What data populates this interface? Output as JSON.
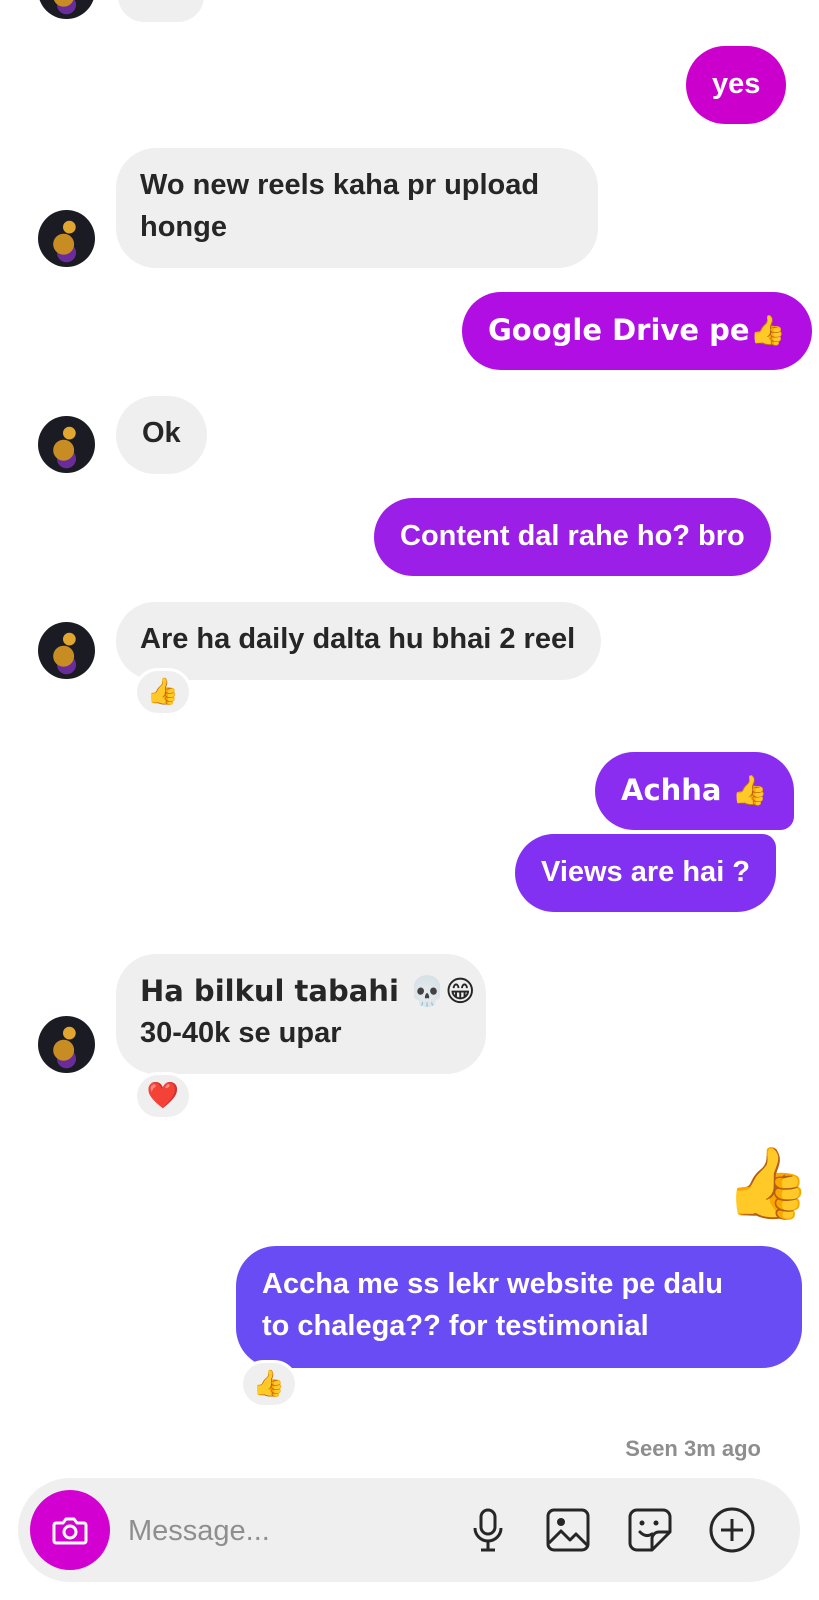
{
  "messages": {
    "m0": "yes",
    "m1_line1": "Wo new reels kaha pr upload",
    "m1_line2": "honge",
    "m2": "Google Drive pe👍",
    "m3": "Ok",
    "m4": "Content dal rahe ho? bro",
    "m5": "Are ha daily dalta hu bhai 2 reel",
    "m5_reaction": "👍",
    "m6": "Achha 👍",
    "m7": "Views are hai ?",
    "m8_line1": "Ha bilkul tabahi 💀😁",
    "m8_line2": "30-40k se upar",
    "m8_reaction": "❤️",
    "m9": "👍",
    "m10_line1": "Accha me ss lekr website pe dalu",
    "m10_line2": "to chalega?? for testimonial",
    "m10_reaction": "👍"
  },
  "status": {
    "seen": "Seen 3m ago"
  },
  "composer": {
    "placeholder": "Message..."
  },
  "icons": {
    "camera": "camera-icon",
    "mic": "microphone-icon",
    "gallery": "image-icon",
    "sticker": "sticker-icon",
    "more": "plus-circle-icon"
  },
  "colors": {
    "incoming_bg": "#efefef",
    "outgoing_magenta": "#cc00cc",
    "outgoing_purple": "#9c1fe8",
    "outgoing_violet": "#7d35f0",
    "outgoing_indigo": "#6a4cf5",
    "camera_button": "#d200d0",
    "seen_text": "#8e8e8e"
  }
}
